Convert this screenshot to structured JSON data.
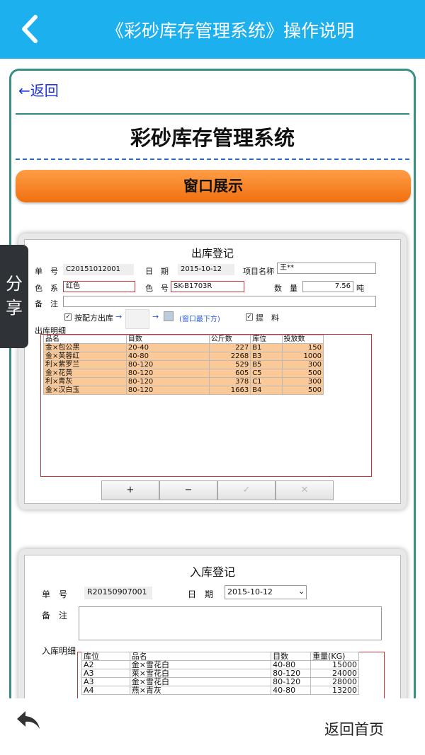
{
  "header": {
    "title": "《彩砂库存管理系统》操作说明",
    "back_icon": "chevron-left-icon"
  },
  "card": {
    "back_link": "←返回",
    "heading": "彩砂库存管理系统",
    "section_banner": "窗口展示"
  },
  "share_tab": {
    "line1": "分",
    "line2": "享"
  },
  "outbound": {
    "title": "出库登记",
    "order_no_label": "单　号",
    "order_no": "C20151012001",
    "date_label": "日　期",
    "date": "2015-10-12",
    "project_label": "项目名称",
    "project": "王**",
    "color_series_label": "色　系",
    "color_series": "红色",
    "color_no_label": "色　号",
    "color_no": "SK-B1703R",
    "qty_label": "数　量",
    "qty": "7.56",
    "qty_unit": "吨",
    "remark_label": "备　注",
    "by_formula_label": "按配方出库",
    "window_hint": "(窗口最下方)",
    "lift_label": "提　料",
    "detail_label": "出库明细",
    "columns": [
      "品名",
      "目数",
      "公斤数",
      "库位",
      "投放数"
    ],
    "rows": [
      [
        "金×包公黑",
        "20-40",
        "227",
        "B1",
        "150"
      ],
      [
        "金×芙蓉红",
        "40-80",
        "2268",
        "B3",
        "1000"
      ],
      [
        "利×紫罗兰",
        "80-120",
        "529",
        "B5",
        "300"
      ],
      [
        "金×花黄",
        "80-120",
        "605",
        "C5",
        "500"
      ],
      [
        "利×青灰",
        "80-120",
        "378",
        "C1",
        "300"
      ],
      [
        "金×汉白玉",
        "80-120",
        "1663",
        "B4",
        "500"
      ]
    ],
    "buttons": [
      "+",
      "−",
      "✓",
      "✕"
    ]
  },
  "inbound": {
    "title": "入库登记",
    "order_no_label": "单　号",
    "order_no": "R20150907001",
    "date_label": "日　期",
    "date": "2015-10-12",
    "remark_label": "备　注",
    "detail_label": "入库明细",
    "columns": [
      "库位",
      "品名",
      "目数",
      "重量(KG)"
    ],
    "rows": [
      [
        "A2",
        "金×雪花白",
        "40-80",
        "15000"
      ],
      [
        "A3",
        "莱×雪花白",
        "80-120",
        "24000"
      ],
      [
        "A3",
        "金×雪花白",
        "80-120",
        "28000"
      ],
      [
        "A4",
        "燕×青灰",
        "40-80",
        "13200"
      ]
    ]
  },
  "footer": {
    "share_icon": "share-arrow-icon",
    "home_link": "返回首页"
  }
}
